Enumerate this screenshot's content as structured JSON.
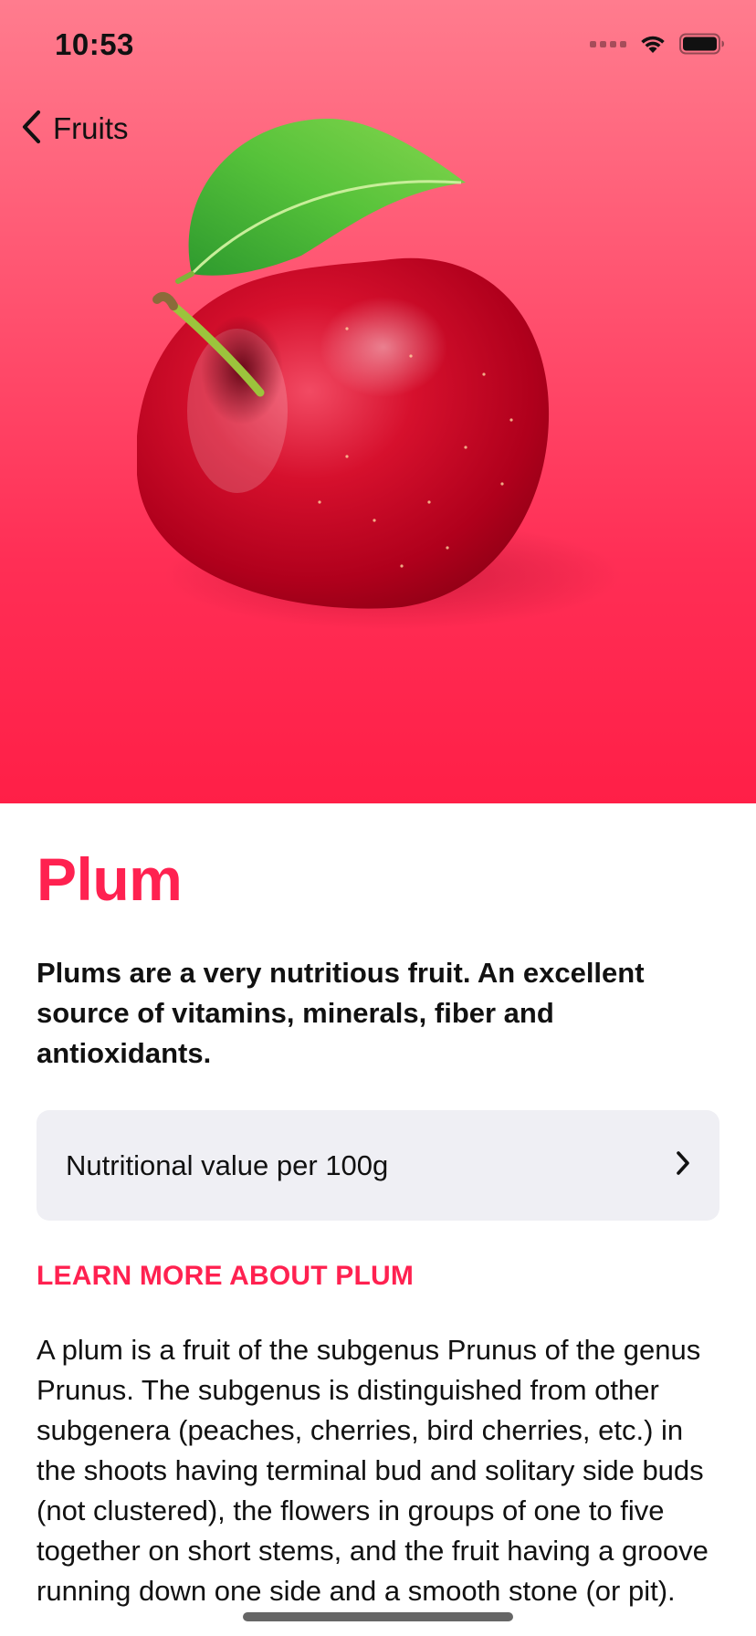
{
  "status_bar": {
    "time": "10:53"
  },
  "nav": {
    "back_label": "Fruits"
  },
  "fruit": {
    "title": "Plum",
    "headline": "Plums are a very nutritious fruit. An excellent source of vitamins, minerals, fiber and antioxidants.",
    "nutrition_label": "Nutritional value per 100g",
    "section_header": "LEARN MORE ABOUT PLUM",
    "description": "A plum is a fruit of the subgenus Prunus of the genus Prunus. The subgenus is distinguished from other subgenera (peaches, cherries, bird cherries, etc.) in the shoots having terminal bud and solitary side buds (not clustered), the flowers in groups of one to five together on short stems, and the fruit having a groove running down one side and a smooth stone (or pit)."
  },
  "colors": {
    "accent": "#FF2150",
    "hero_gradient_top": "#FF7C8E",
    "hero_gradient_bottom": "#FF1F47",
    "row_background": "#EFEFF4"
  },
  "icons": {
    "back": "chevron-left-icon",
    "disclosure": "chevron-right-icon",
    "wifi": "wifi-icon",
    "battery": "battery-icon",
    "signal": "cellular-signal-icon"
  }
}
